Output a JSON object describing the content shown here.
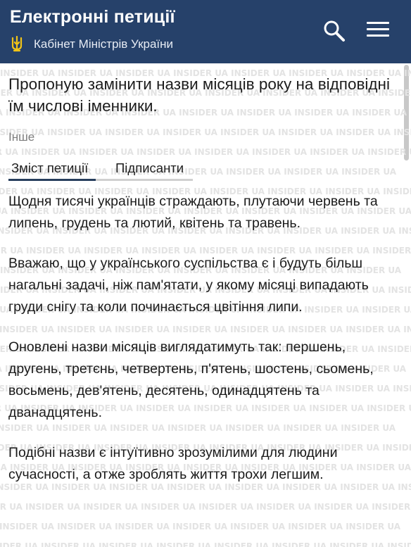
{
  "header": {
    "title": "Електронні петиції",
    "subtitle": "Кабінет Міністрів України",
    "background": "#26416a",
    "search_icon": "search-icon",
    "menu_icon": "hamburger-menu-icon"
  },
  "petition": {
    "title": "Пропоную замінити назви місяців року на відповідні їм числові іменники.",
    "category": "Інше"
  },
  "tabs": [
    {
      "label": "Зміст петиції",
      "active": true
    },
    {
      "label": "Підписанти",
      "active": false
    }
  ],
  "body": {
    "paragraphs": [
      "Щодня тисячі українців страждають, плутаючи червень та липень, грудень та лютий, квітень та травень.",
      "Вважаю, що у українського суспільства є і будуть більш нагальні задачі, ніж пам'ятати, у якому місяці випадають груди снігу та коли починається цвітіння липи.",
      "Оновлені назви місяців виглядатимуть так: першень, другень, третєнь, четвертень, п'ятень, шостень, сьомень, восьмень, дев'ятень, десятень, одинадцятень та дванадцятень.",
      "Подібні назви є інтуїтивно зрозумілими для людини сучасності, а отже зроблять життя трохи легшим."
    ]
  },
  "watermark": {
    "text": "INSIDER UA"
  }
}
